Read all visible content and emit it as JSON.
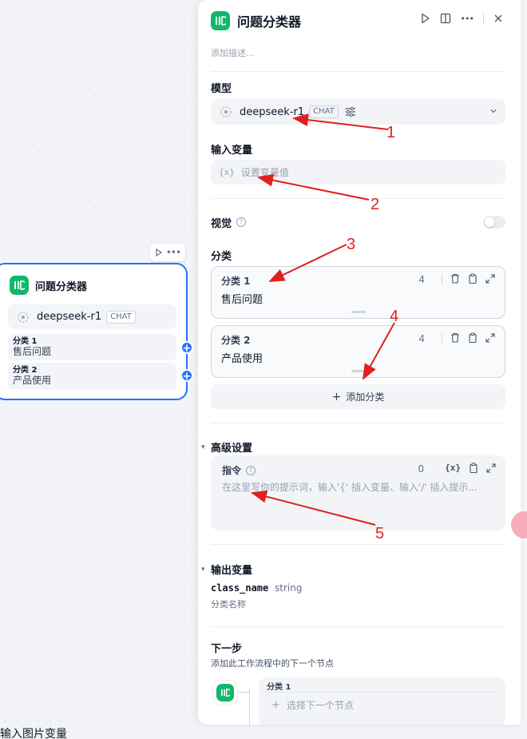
{
  "canvas": {
    "bottom_text": "输入图片变量",
    "node": {
      "title": "问题分类器",
      "model_name": "deepseek-r1",
      "model_badge": "CHAT",
      "classes": [
        {
          "label": "分类 1",
          "value": "售后问题"
        },
        {
          "label": "分类 2",
          "value": "产品使用"
        }
      ]
    }
  },
  "panel": {
    "title": "问题分类器",
    "description_placeholder": "添加描述...",
    "model_section_label": "模型",
    "model_name": "deepseek-r1",
    "model_badge": "CHAT",
    "input_variable_label": "输入变量",
    "input_variable_placeholder": "设置变量值",
    "input_variable_icon": "{x}",
    "vision_label": "视觉",
    "vision_enabled": false,
    "classes_label": "分类",
    "classes": [
      {
        "label": "分类 1",
        "value": "售后问题",
        "count": "4"
      },
      {
        "label": "分类 2",
        "value": "产品使用",
        "count": "4"
      }
    ],
    "add_class_label": "添加分类",
    "advanced_label": "高级设置",
    "instruction_label": "指令",
    "instruction_count": "0",
    "instruction_var_icon": "{x}",
    "instruction_placeholder": "在这里写你的提示词，输入'{' 插入变量、输入'/' 插入提示...",
    "output_label": "输出变量",
    "output_var_name": "class_name",
    "output_var_type": "string",
    "output_var_desc": "分类名称",
    "next_step_label": "下一步",
    "next_step_desc": "添加此工作流程中的下一个节点",
    "next_branch_label": "分类 1",
    "next_select_placeholder": "选择下一个节点"
  },
  "annotations": [
    "1",
    "2",
    "3",
    "4",
    "5"
  ],
  "colors": {
    "accent": "#2970ff",
    "node_icon": "#12b76a",
    "annotation": "#e02020"
  }
}
